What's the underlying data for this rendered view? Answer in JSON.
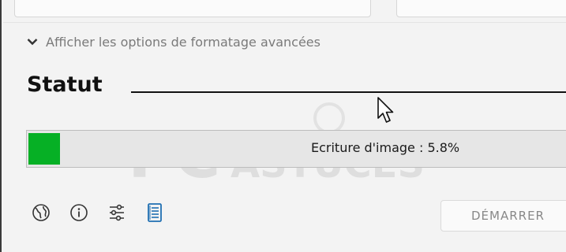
{
  "advanced_options": {
    "label": "Afficher les options de formatage avancées"
  },
  "status": {
    "title": "Statut",
    "progress_text": "Ecriture d'image : 5.8%",
    "progress_fraction": 0.058
  },
  "watermark": {
    "text": "PC ASTUCES"
  },
  "toolbar": {
    "icons": [
      "globe-icon",
      "info-icon",
      "sliders-icon",
      "log-icon"
    ],
    "start_label": "DÉMARRER"
  },
  "colors": {
    "progress_fill": "#06b025",
    "log_icon_accent": "#1f6fb2"
  }
}
